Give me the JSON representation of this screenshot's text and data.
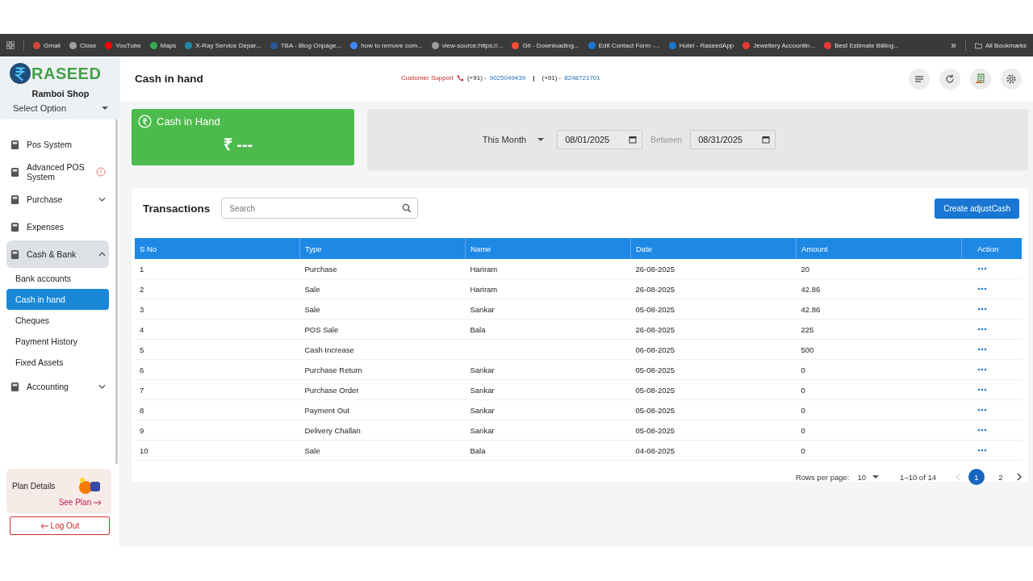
{
  "bookmarks": [
    {
      "label": "Gmail",
      "color": "#d44638"
    },
    {
      "label": "Close",
      "color": "#9e9e9e"
    },
    {
      "label": "YouTube",
      "color": "#ff0000"
    },
    {
      "label": "Maps",
      "color": "#34a853"
    },
    {
      "label": "X-Ray Service Depar...",
      "color": "#1e88a8"
    },
    {
      "label": "TBA - Blog Onpage...",
      "color": "#2b579a"
    },
    {
      "label": "how to remove com...",
      "color": "#4285f4"
    },
    {
      "label": "view-source:https://...",
      "color": "#9e9e9e"
    },
    {
      "label": "Git - Downloading...",
      "color": "#f05033"
    },
    {
      "label": "Edit Contact Form -...",
      "color": "#1976d2"
    },
    {
      "label": "Hotel - RaseedApp",
      "color": "#1976d2"
    },
    {
      "label": "Jewellery Accountin...",
      "color": "#e53935"
    },
    {
      "label": "Best Estimate Billing...",
      "color": "#e53935"
    }
  ],
  "bookmarks_more": "»",
  "all_bookmarks": "All Bookmarks",
  "brand": {
    "name": "RASEED",
    "shop": "Ramboi Shop",
    "select": "Select Option"
  },
  "sidebar": {
    "items": [
      {
        "label": "Pos System",
        "kind": "plain"
      },
      {
        "label": "Advanced POS System",
        "kind": "alert"
      },
      {
        "label": "Purchase",
        "kind": "group",
        "expanded": false
      },
      {
        "label": "Expenses",
        "kind": "plain"
      },
      {
        "label": "Cash & Bank",
        "kind": "group",
        "expanded": true,
        "children": [
          {
            "label": "Bank accounts",
            "selected": false
          },
          {
            "label": "Cash in hand",
            "selected": true
          },
          {
            "label": "Cheques",
            "selected": false
          },
          {
            "label": "Payment History",
            "selected": false
          },
          {
            "label": "Fixed Assets",
            "selected": false
          }
        ]
      },
      {
        "label": "Accounting",
        "kind": "group",
        "expanded": false
      }
    ]
  },
  "plan": {
    "title": "Plan Details",
    "link": "See Plan"
  },
  "logout": "Log Out",
  "header": {
    "title": "Cash in hand",
    "support": "Customer Support",
    "phone1_code": "(+91) -",
    "phone1": "9025049439",
    "sep": "|",
    "phone2_code": "(+91) -",
    "phone2": "8248721701"
  },
  "summary": {
    "title": "Cash in Hand",
    "value": "₹ ---"
  },
  "filter": {
    "period": "This Month",
    "from": "08/01/2025",
    "between": "Between",
    "to": "08/31/2025"
  },
  "transactions": {
    "title": "Transactions",
    "search_placeholder": "Search",
    "create": "Create adjustCash",
    "columns": [
      "S No",
      "Type",
      "Name",
      "Date",
      "Amount",
      "Action"
    ],
    "rows": [
      [
        "1",
        "Purchase",
        "Hariram",
        "26-08-2025",
        "20"
      ],
      [
        "2",
        "Sale",
        "Hariram",
        "26-08-2025",
        "42.86"
      ],
      [
        "3",
        "Sale",
        "Sankar",
        "05-08-2025",
        "42.86"
      ],
      [
        "4",
        "POS Sale",
        "Bala",
        "26-08-2025",
        "225"
      ],
      [
        "5",
        "Cash Increase",
        "",
        "06-08-2025",
        "500"
      ],
      [
        "6",
        "Purchase Return",
        "Sankar",
        "05-08-2025",
        "0"
      ],
      [
        "7",
        "Purchase Order",
        "Sankar",
        "05-08-2025",
        "0"
      ],
      [
        "8",
        "Payment Out",
        "Sankar",
        "05-08-2025",
        "0"
      ],
      [
        "9",
        "Delivery Challan",
        "Sankar",
        "05-08-2025",
        "0"
      ],
      [
        "10",
        "Sale",
        "Bala",
        "04-08-2025",
        "0"
      ]
    ],
    "rows_per_page_label": "Rows per page:",
    "rows_per_page": "10",
    "range": "1–10 of 14",
    "pages": [
      {
        "label": "1",
        "selected": true
      },
      {
        "label": "2",
        "selected": false
      }
    ]
  }
}
